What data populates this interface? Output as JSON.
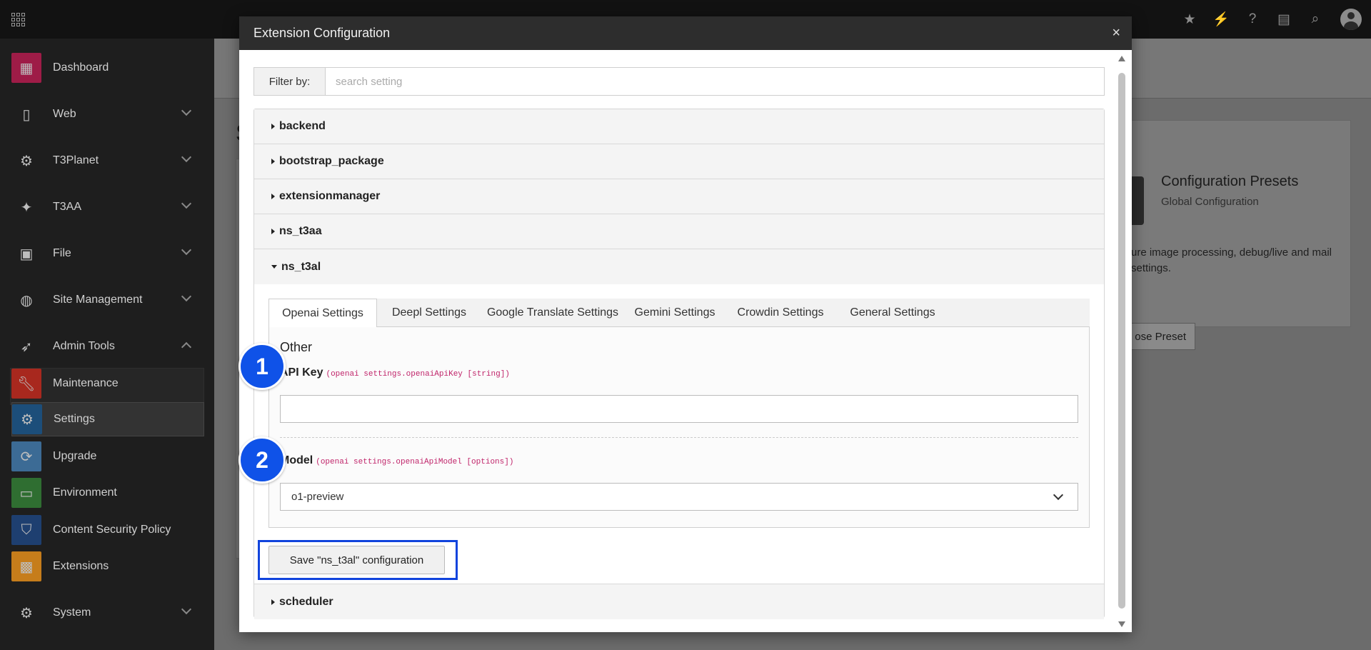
{
  "sidebar": {
    "items": [
      {
        "label": "Dashboard"
      },
      {
        "label": "Web"
      },
      {
        "label": "T3Planet"
      },
      {
        "label": "T3AA"
      },
      {
        "label": "File"
      },
      {
        "label": "Site Management"
      },
      {
        "label": "Admin Tools"
      },
      {
        "label": "Maintenance"
      },
      {
        "label": "Settings"
      },
      {
        "label": "Upgrade"
      },
      {
        "label": "Environment"
      },
      {
        "label": "Content Security Policy"
      },
      {
        "label": "Extensions"
      },
      {
        "label": "System"
      }
    ]
  },
  "background": {
    "preset_title": "Configuration Presets",
    "preset_subtitle": "Global Configuration",
    "preset_desc": "ure image processing, debug/live and mail settings.",
    "preset_button": "ose Preset",
    "heading_letter": "S"
  },
  "modal": {
    "title": "Extension Configuration",
    "close": "×",
    "filter_label": "Filter by:",
    "filter_placeholder": "search setting",
    "accordion": [
      {
        "label": "backend"
      },
      {
        "label": "bootstrap_package"
      },
      {
        "label": "extensionmanager"
      },
      {
        "label": "ns_t3aa"
      },
      {
        "label": "ns_t3al"
      },
      {
        "label": "scheduler"
      }
    ],
    "tabs": [
      {
        "label": "Openai Settings"
      },
      {
        "label": "Deepl Settings"
      },
      {
        "label": "Google Translate Settings"
      },
      {
        "label": "Gemini Settings"
      },
      {
        "label": "Crowdin Settings"
      },
      {
        "label": "General Settings"
      }
    ],
    "section_title": "Other",
    "fields": {
      "api_key": {
        "label": "API Key",
        "code": "(openai settings.openaiApiKey [string])",
        "value": ""
      },
      "model": {
        "label": "Model",
        "code": "(openai settings.openaiApiModel [options])",
        "value": "o1-preview"
      }
    },
    "save_button": "Save \"ns_t3al\" configuration"
  },
  "badges": [
    "1",
    "2"
  ],
  "colors": {
    "badge": "#0f52e8",
    "highlight": "#1144dd",
    "code_text": "#c0246a",
    "modal_header": "#2d2d2d"
  }
}
